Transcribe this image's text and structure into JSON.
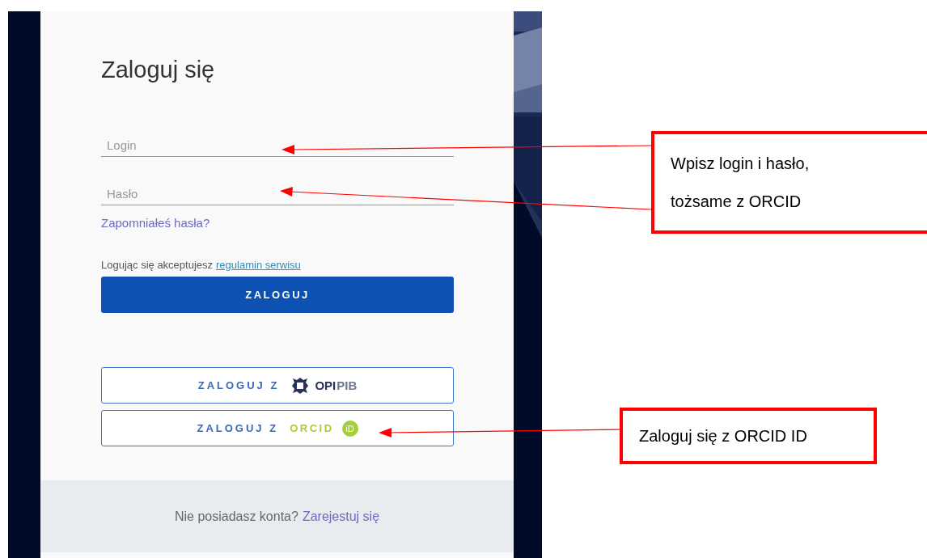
{
  "title": "Zaloguj się",
  "fields": [
    {
      "placeholder": "Login"
    },
    {
      "placeholder": "Hasło"
    }
  ],
  "forgot_link": "Zapomniałeś hasła?",
  "terms": {
    "text": "Logując się akceptujesz",
    "link": "regulamin serwisu"
  },
  "login_button": "ZALOGUJ",
  "providers": [
    {
      "kind": "opi",
      "label": "ZALOGUJ Z",
      "logo_text": [
        "OPI",
        "PIB"
      ]
    },
    {
      "kind": "orcid",
      "label": "ZALOGUJ Z",
      "brand": "ORCID",
      "badge": "iD"
    }
  ],
  "footer": {
    "text": "Nie posiadasz konta?",
    "link": "Zarejestuj się"
  },
  "annotations": [
    {
      "lines": [
        "Wpisz login i hasło,",
        "tożsame z ORCID"
      ]
    },
    {
      "lines": [
        "Zaloguj się z ORCID ID"
      ]
    }
  ]
}
